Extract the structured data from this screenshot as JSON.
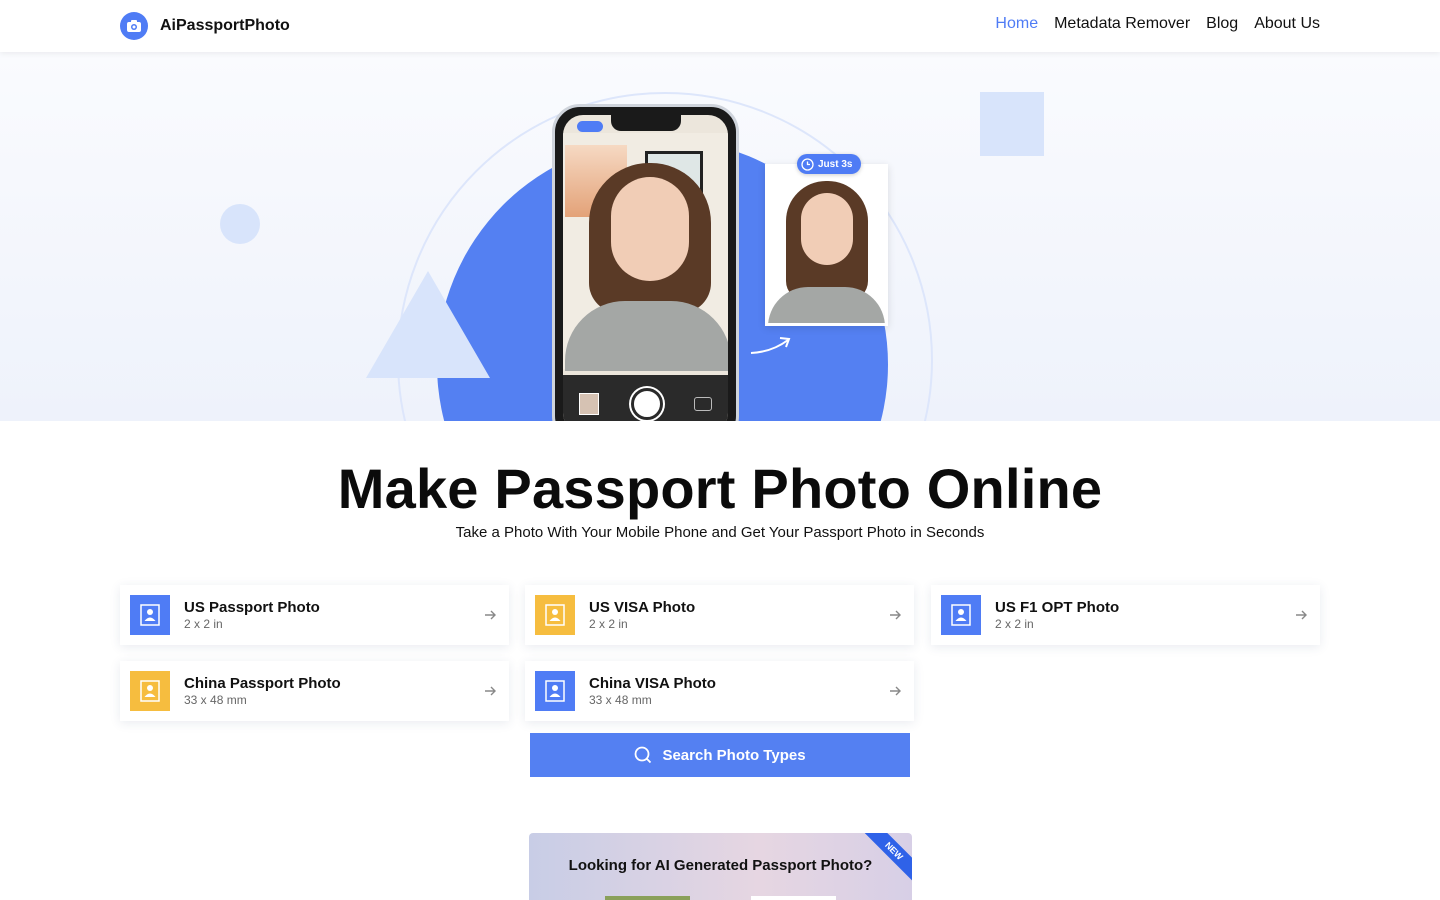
{
  "brand": {
    "name": "AiPassportPhoto"
  },
  "nav": {
    "items": [
      "Home",
      "Metadata Remover",
      "Blog",
      "About Us"
    ],
    "active": "Home"
  },
  "hero": {
    "badge": "Just 3s"
  },
  "headline": "Make Passport Photo Online",
  "subheadline": "Take a Photo With Your Mobile Phone and Get Your Passport Photo in Seconds",
  "photo_types": [
    {
      "title": "US Passport Photo",
      "size": "2 x 2 in",
      "icon_color": "#4f7cf5"
    },
    {
      "title": "US VISA Photo",
      "size": "2 x 2 in",
      "icon_color": "#f6bd3f"
    },
    {
      "title": "US F1 OPT Photo",
      "size": "2 x 2 in",
      "icon_color": "#4f7cf5"
    },
    {
      "title": "China Passport Photo",
      "size": "33 x 48 mm",
      "icon_color": "#f6bd3f"
    },
    {
      "title": "China VISA Photo",
      "size": "33 x 48 mm",
      "icon_color": "#4f7cf5"
    }
  ],
  "search_button": {
    "label": "Search Photo Types"
  },
  "promo": {
    "title": "Looking for AI Generated Passport Photo?",
    "ribbon": "NEW"
  },
  "colors": {
    "accent": "#4f7cf5",
    "yellow": "#f6bd3f",
    "hero_bg": "#eef2fb"
  }
}
